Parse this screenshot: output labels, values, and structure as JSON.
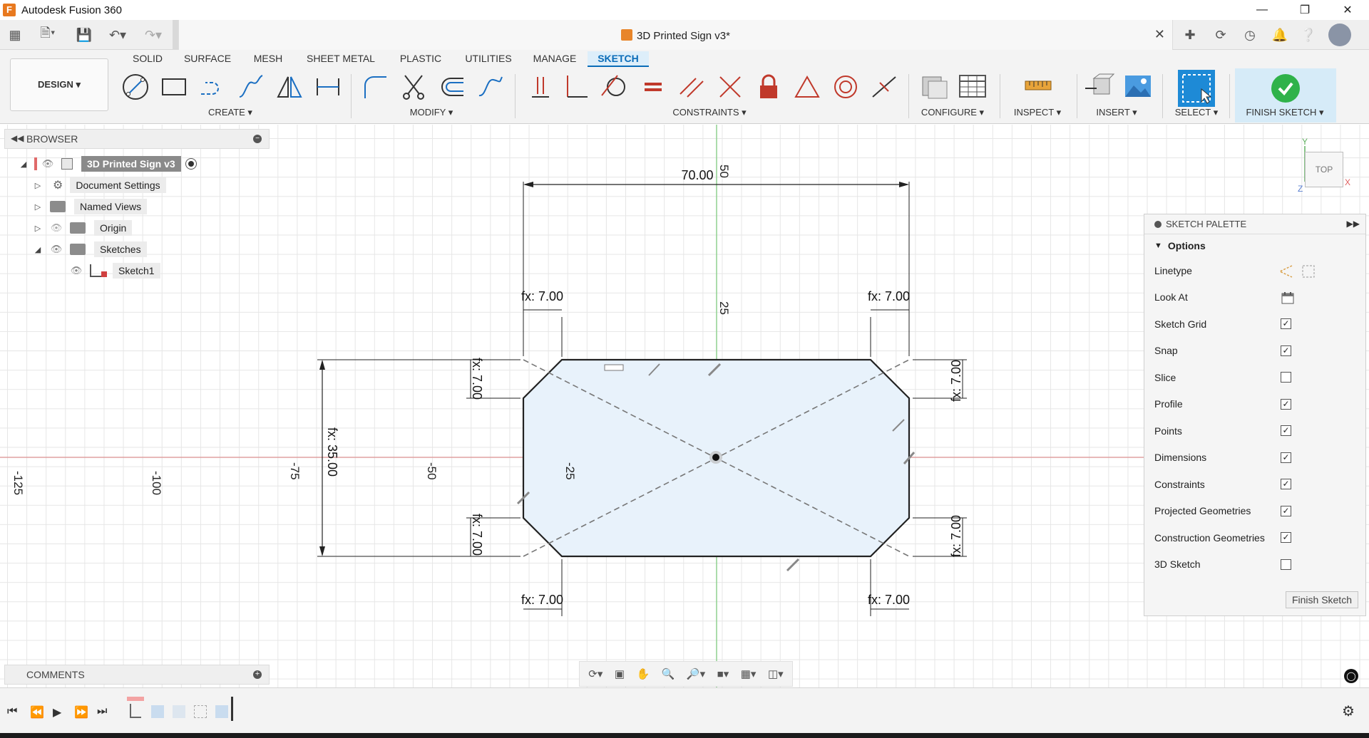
{
  "window": {
    "title": "Autodesk Fusion 360",
    "logo": "F"
  },
  "document": {
    "title": "3D Printed Sign v3*"
  },
  "workspace": {
    "label": "DESIGN ▾"
  },
  "tabs": [
    "SOLID",
    "SURFACE",
    "MESH",
    "SHEET METAL",
    "PLASTIC",
    "UTILITIES",
    "MANAGE",
    "SKETCH"
  ],
  "active_tab": "SKETCH",
  "groups": {
    "create": "CREATE ▾",
    "modify": "MODIFY ▾",
    "constraints": "CONSTRAINTS ▾",
    "configure": "CONFIGURE ▾",
    "inspect": "INSPECT ▾",
    "insert": "INSERT ▾",
    "select": "SELECT ▾",
    "finish": "FINISH SKETCH ▾"
  },
  "browser": {
    "title": "BROWSER",
    "items": [
      {
        "label": "3D Printed Sign v3"
      },
      {
        "label": "Document Settings"
      },
      {
        "label": "Named Views"
      },
      {
        "label": "Origin"
      },
      {
        "label": "Sketches"
      },
      {
        "label": "Sketch1"
      }
    ]
  },
  "comments": {
    "title": "COMMENTS"
  },
  "sketch": {
    "axis_labels": {
      "h_neg125": "-125",
      "h_neg100": "-100",
      "h_neg75": "-75",
      "h_neg50": "-50",
      "h_neg25": "-25",
      "v_50": "50",
      "v_25": "25"
    },
    "dimensions": {
      "width": "70.00",
      "height": "fx: 35.00",
      "chamfer_top_left": "fx: 7.00",
      "chamfer_top_right": "fx: 7.00",
      "chamfer_bottom_left": "fx: 7.00",
      "chamfer_bottom_right": "fx: 7.00",
      "chamfer_left_top": "fx: 7.00",
      "chamfer_left_bottom": "fx: 7.00",
      "chamfer_right_top": "fx: 7.00",
      "chamfer_right_bottom": "fx: 7.00"
    }
  },
  "viewcube": {
    "face": "TOP",
    "axis_x": "X",
    "axis_y": "Y",
    "axis_z": "Z"
  },
  "palette": {
    "title": "SKETCH PALETTE",
    "options_label": "Options",
    "rows": [
      {
        "label": "Linetype"
      },
      {
        "label": "Look At"
      },
      {
        "label": "Sketch Grid",
        "checked": true
      },
      {
        "label": "Snap",
        "checked": true
      },
      {
        "label": "Slice",
        "checked": false
      },
      {
        "label": "Profile",
        "checked": true
      },
      {
        "label": "Points",
        "checked": true
      },
      {
        "label": "Dimensions",
        "checked": true
      },
      {
        "label": "Constraints",
        "checked": true
      },
      {
        "label": "Projected Geometries",
        "checked": true
      },
      {
        "label": "Construction Geometries",
        "checked": true
      },
      {
        "label": "3D Sketch",
        "checked": false
      }
    ],
    "finish_label": "Finish Sketch"
  },
  "colors": {
    "accent": "#0a6cb8",
    "profile_fill": "#e8f2fb",
    "x_axis": "#e0a0a0",
    "y_axis": "#8fd18f",
    "finish_green": "#2fb24a"
  }
}
